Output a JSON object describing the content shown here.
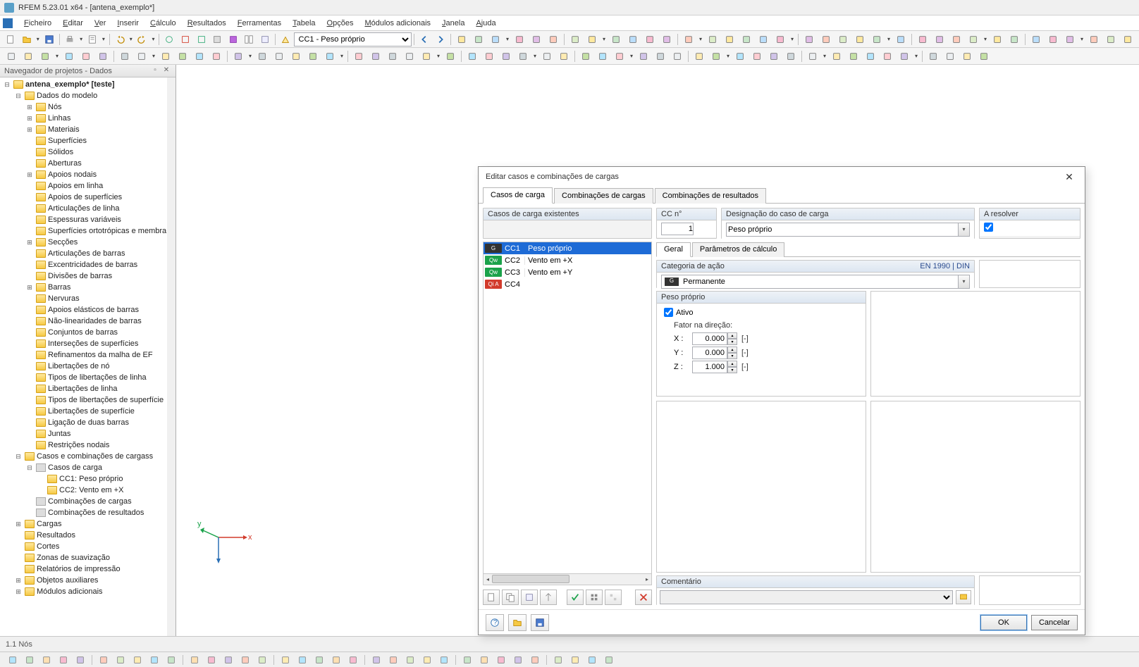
{
  "app": {
    "title": "RFEM 5.23.01 x64 - [antena_exemplo*]"
  },
  "menu": [
    "Ficheiro",
    "Editar",
    "Ver",
    "Inserir",
    "Cálculo",
    "Resultados",
    "Ferramentas",
    "Tabela",
    "Opções",
    "Módulos adicionais",
    "Janela",
    "Ajuda"
  ],
  "toolbar1_combo": "CC1 - Peso próprio",
  "navigator": {
    "title": "Navegador de projetos - Dados",
    "root": "antena_exemplo* [teste]",
    "nodes": [
      {
        "l": "Dados do modelo",
        "d": 1,
        "e": "−",
        "children": [
          {
            "l": "Nós",
            "d": 2,
            "e": "+"
          },
          {
            "l": "Linhas",
            "d": 2,
            "e": "+"
          },
          {
            "l": "Materiais",
            "d": 2,
            "e": "+"
          },
          {
            "l": "Superfícies",
            "d": 2
          },
          {
            "l": "Sólidos",
            "d": 2
          },
          {
            "l": "Aberturas",
            "d": 2
          },
          {
            "l": "Apoios nodais",
            "d": 2,
            "e": "+"
          },
          {
            "l": "Apoios em linha",
            "d": 2
          },
          {
            "l": "Apoios de superfícies",
            "d": 2
          },
          {
            "l": "Articulações de linha",
            "d": 2
          },
          {
            "l": "Espessuras variáveis",
            "d": 2
          },
          {
            "l": "Superfícies ortotrópicas e membra",
            "d": 2
          },
          {
            "l": "Secções",
            "d": 2,
            "e": "+"
          },
          {
            "l": "Articulações de barras",
            "d": 2
          },
          {
            "l": "Excentricidades de barras",
            "d": 2
          },
          {
            "l": "Divisões de barras",
            "d": 2
          },
          {
            "l": "Barras",
            "d": 2,
            "e": "+"
          },
          {
            "l": "Nervuras",
            "d": 2
          },
          {
            "l": "Apoios elásticos de barras",
            "d": 2
          },
          {
            "l": "Não-linearidades de barras",
            "d": 2
          },
          {
            "l": "Conjuntos de barras",
            "d": 2
          },
          {
            "l": "Interseções de superfícies",
            "d": 2
          },
          {
            "l": "Refinamentos da malha de EF",
            "d": 2
          },
          {
            "l": "Libertações de nó",
            "d": 2
          },
          {
            "l": "Tipos de libertações de linha",
            "d": 2
          },
          {
            "l": "Libertações de linha",
            "d": 2
          },
          {
            "l": "Tipos de libertações de superfície",
            "d": 2
          },
          {
            "l": "Libertações de superfície",
            "d": 2
          },
          {
            "l": "Ligação de duas barras",
            "d": 2
          },
          {
            "l": "Juntas",
            "d": 2
          },
          {
            "l": "Restrições nodais",
            "d": 2
          }
        ]
      },
      {
        "l": "Casos e combinações de cargass",
        "d": 1,
        "e": "−",
        "children": [
          {
            "l": "Casos de carga",
            "d": 2,
            "e": "−",
            "i": "item",
            "children": [
              {
                "l": "CC1: Peso próprio",
                "d": 3,
                "i": "file"
              },
              {
                "l": "CC2: Vento em +X",
                "d": 3,
                "i": "file"
              }
            ]
          },
          {
            "l": "Combinações de cargas",
            "d": 2,
            "i": "item"
          },
          {
            "l": "Combinações de resultados",
            "d": 2,
            "i": "item"
          }
        ]
      },
      {
        "l": "Cargas",
        "d": 1,
        "e": "+"
      },
      {
        "l": "Resultados",
        "d": 1
      },
      {
        "l": "Cortes",
        "d": 1
      },
      {
        "l": "Zonas de suavização",
        "d": 1
      },
      {
        "l": "Relatórios de impressão",
        "d": 1
      },
      {
        "l": "Objetos auxiliares",
        "d": 1,
        "e": "+"
      },
      {
        "l": "Módulos adicionais",
        "d": 1,
        "e": "+"
      }
    ]
  },
  "dialog": {
    "title": "Editar casos e combinações de cargas",
    "tabs": [
      "Casos de carga",
      "Combinações de cargas",
      "Combinações de resultados"
    ],
    "existing_hd": "Casos de carga existentes",
    "ccno_hd": "CC n°",
    "ccno_val": "1",
    "desig_hd": "Designação do caso de carga",
    "desig_val": "Peso próprio",
    "resolve_hd": "A resolver",
    "lc_rows": [
      {
        "badge": "G",
        "bg": "#333333",
        "id": "CC1",
        "name": "Peso próprio",
        "sel": true
      },
      {
        "badge": "Qw",
        "bg": "#1aa24a",
        "id": "CC2",
        "name": "Vento em +X"
      },
      {
        "badge": "Qw",
        "bg": "#1aa24a",
        "id": "CC3",
        "name": "Vento em +Y"
      },
      {
        "badge": "Qi A",
        "bg": "#d23b2c",
        "id": "CC4",
        "name": ""
      }
    ],
    "subtabs": [
      "Geral",
      "Parâmetros de cálculo"
    ],
    "action_hd": "Categoria de ação",
    "action_std": "EN 1990 | DIN",
    "action_val": "Permanente",
    "peso_hd": "Peso próprio",
    "ativo": "Ativo",
    "dir_label": "Fator na direção:",
    "dir": {
      "x_l": "X :",
      "y_l": "Y :",
      "z_l": "Z :",
      "x": "0.000",
      "y": "0.000",
      "z": "1.000",
      "unit": "[-]"
    },
    "comment_hd": "Comentário",
    "ok": "OK",
    "cancel": "Cancelar"
  },
  "status": {
    "left": "1.1 Nós"
  }
}
